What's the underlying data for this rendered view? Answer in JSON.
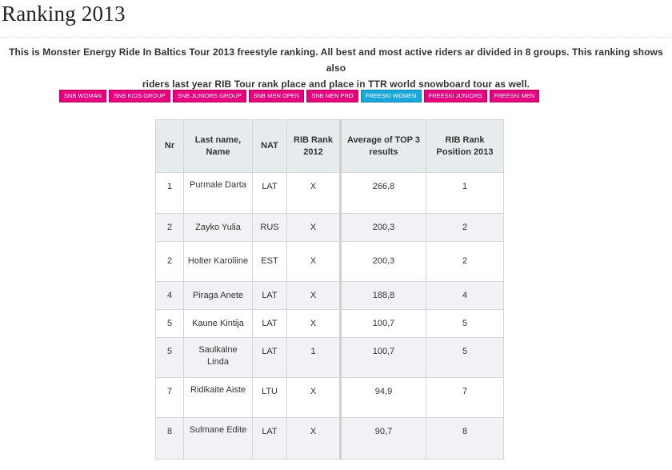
{
  "page": {
    "title": "Ranking 2013",
    "intro_line1": "This is Monster Energy Ride In Baltics Tour 2013 freestyle ranking. All best and most active riders ar divided in 8 groups. This ranking shows also",
    "intro_line2": "riders last year RIB Tour rank place and place in TTR world snowboard tour as well."
  },
  "tabs": [
    {
      "label": "SNB WOMAN",
      "active": false
    },
    {
      "label": "SNB KIDS GROUP",
      "active": false
    },
    {
      "label": "SNB JUNIORS GROUP",
      "active": false
    },
    {
      "label": "SNB MEN OPEN",
      "active": false
    },
    {
      "label": "SNB MEN PRO",
      "active": false
    },
    {
      "label": "FREESKI WOMEN",
      "active": true
    },
    {
      "label": "FREESKI JUNIORS",
      "active": false
    },
    {
      "label": "FREESKI MEN",
      "active": false
    }
  ],
  "colors": {
    "tab_bg": "#e6007e",
    "tab_active_bg": "#1aa7dc",
    "header_bg": "#e6ecee"
  },
  "table": {
    "headers": {
      "nr": "Nr",
      "name": "Last name, Name",
      "nat": "NAT",
      "rib2012": "RIB Rank 2012",
      "avg": "Average of TOP 3 results",
      "pos2013": "RIB Rank Position 2013"
    },
    "rows": [
      {
        "nr": "1",
        "name": "Purmale Darta",
        "nat": "LAT",
        "rib2012": "X",
        "avg": "266,8",
        "pos2013": "1"
      },
      {
        "nr": "2",
        "name": "Zayko Yulia",
        "nat": "RUS",
        "rib2012": "X",
        "avg": "200,3",
        "pos2013": "2"
      },
      {
        "nr": "2",
        "name": "Holter Karoliine",
        "nat": "EST",
        "rib2012": "X",
        "avg": "200,3",
        "pos2013": "2"
      },
      {
        "nr": "4",
        "name": "Piraga Anete",
        "nat": "LAT",
        "rib2012": "X",
        "avg": "188,8",
        "pos2013": "4"
      },
      {
        "nr": "5",
        "name": "Kaune Kintija",
        "nat": "LAT",
        "rib2012": "X",
        "avg": "100,7",
        "pos2013": "5"
      },
      {
        "nr": "5",
        "name": "Saulkalne Linda",
        "nat": "LAT",
        "rib2012": "1",
        "avg": "100,7",
        "pos2013": "5"
      },
      {
        "nr": "7",
        "name": "Ridikaite Aiste",
        "nat": "LTU",
        "rib2012": "X",
        "avg": "94,9",
        "pos2013": "7"
      },
      {
        "nr": "8",
        "name": "Sulmane Edite",
        "nat": "LAT",
        "rib2012": "X",
        "avg": "90,7",
        "pos2013": "8"
      }
    ]
  }
}
